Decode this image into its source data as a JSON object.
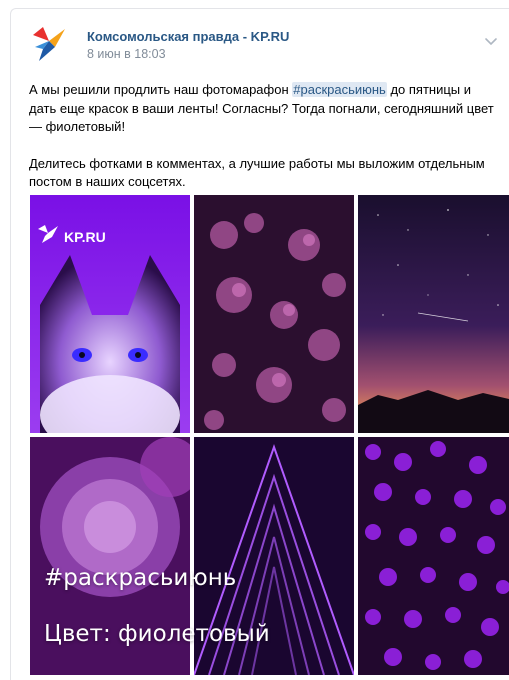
{
  "post": {
    "author": "Комсомольская правда - KP.RU",
    "date": "8 июн в 18:03",
    "text_part1": "А мы решили продлить наш фотомарафон ",
    "hashtag": "#раскрасьиюнь",
    "text_part2": " до пятницы и дать еще красок в ваши ленты! Согласны? Тогда погнали, сегодняшний цвет — фиолетовый!",
    "paragraph2": "Делитесь фотками в комментах, а лучшие работы мы выложим отдельным постом в наших соцсетях."
  },
  "collage": {
    "logo_text": "KP.RU",
    "overlay_hashtag": "#раскрасьиюнь",
    "overlay_color": "Цвет: фиолетовый"
  },
  "colors": {
    "link": "#2a5885",
    "muted": "#818c99",
    "purple": "#8a1fd6"
  },
  "icons": {
    "avatar": "kp-swallow-logo",
    "menu": "chevron-down-icon"
  }
}
